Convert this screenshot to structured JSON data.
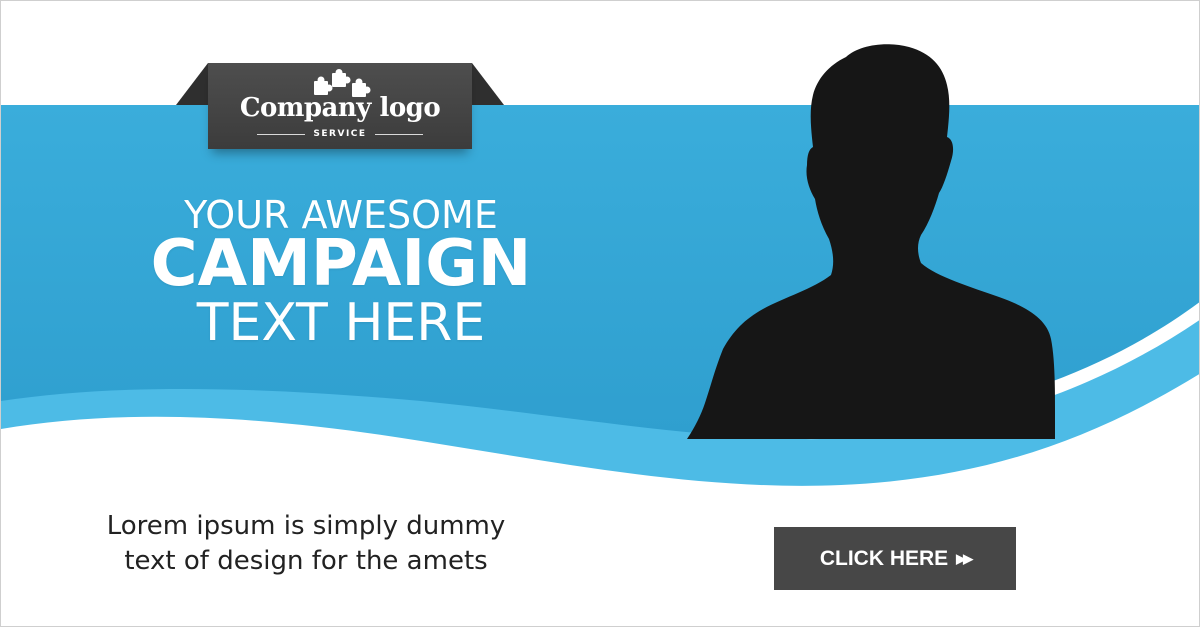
{
  "colors": {
    "band_blue": "#3aaddb",
    "wave_blue": "#4dbbe6",
    "logo_bg": "#444444",
    "button_bg": "#474747",
    "silhouette": "#161616"
  },
  "logo": {
    "icon": "puzzle-pieces-icon",
    "title": "Company logo",
    "subtitle": "SERVICE"
  },
  "headline": {
    "line1": "YOUR AWESOME",
    "line2": "CAMPAIGN",
    "line3": "TEXT HERE"
  },
  "body": {
    "line1": "Lorem ipsum is simply dummy",
    "line2": "text of design for the amets"
  },
  "cta": {
    "label": "CLICK HERE",
    "icon": "fast-forward-icon",
    "glyph": "▶▶"
  }
}
